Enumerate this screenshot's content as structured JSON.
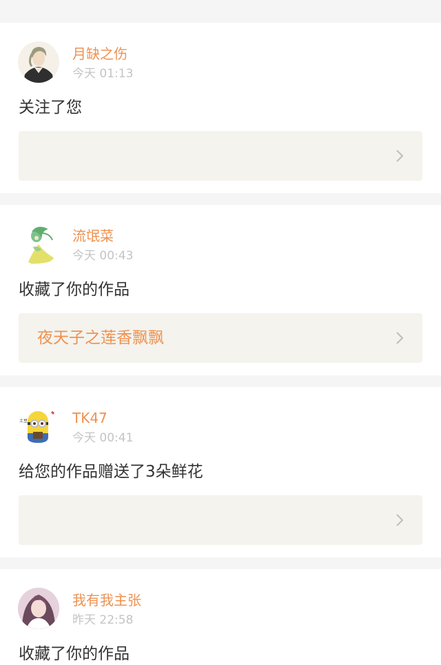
{
  "notifications": [
    {
      "username": "月缺之伤",
      "time": "今天 01:13",
      "action": "关注了您",
      "work_title": "",
      "avatar_icon": "avatar-illustrated-man"
    },
    {
      "username": "流氓菜",
      "time": "今天 00:43",
      "action": "收藏了你的作品",
      "work_title": "夜天子之莲香飘飘",
      "avatar_icon": "avatar-green-fairy"
    },
    {
      "username": "TK47",
      "time": "今天 00:41",
      "action": "给您的作品赠送了3朵鲜花",
      "work_title": "",
      "avatar_icon": "avatar-minion"
    },
    {
      "username": "我有我主张",
      "time": "昨天 22:58",
      "action": "收藏了你的作品",
      "avatar_icon": "avatar-photo-girl"
    }
  ],
  "colors": {
    "accent": "#ef9150",
    "timestamp": "#c4c4c4",
    "linkbox": "#f4f3ee",
    "background": "#f5f5f5"
  }
}
